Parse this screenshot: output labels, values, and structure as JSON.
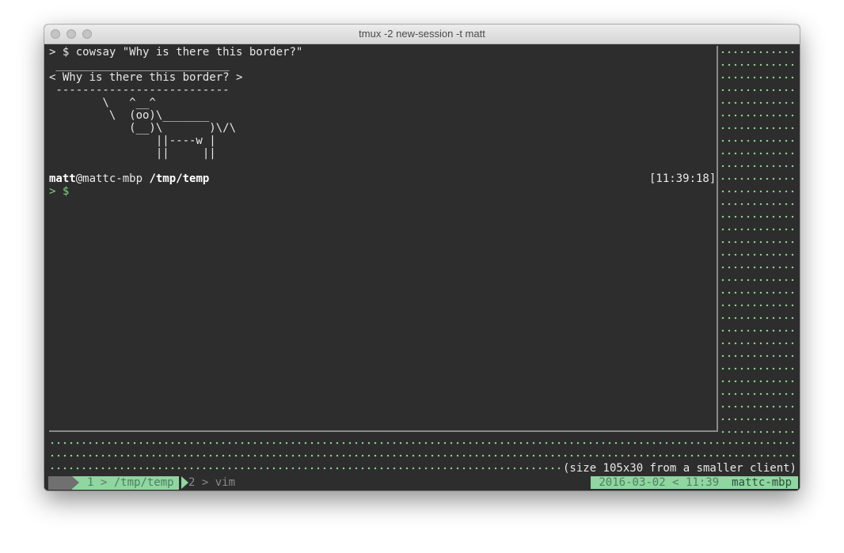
{
  "window": {
    "title": "tmux -2 new-session -t matt"
  },
  "terminal": {
    "command_prompt": "> $",
    "command": " cowsay \"Why is there this border?\"",
    "cow_lines": [
      " __________________________",
      "< Why is there this border? >",
      " --------------------------",
      "        \\   ^__^",
      "         \\  (oo)\\_______",
      "            (__)\\       )\\/\\",
      "                ||----w |",
      "                ||     ||"
    ],
    "prompt_user": "matt",
    "prompt_host": "@mattc-mbp",
    "prompt_path": " /tmp/temp",
    "prompt_time": "[11:39:18]",
    "current_prompt": "> $"
  },
  "tmux": {
    "size_message": "(size 105x30 from a smaller client)",
    "window1_label": "1 ",
    "window1_sep": ">",
    "window1_name": " /tmp/temp",
    "window2_label": "2 ",
    "window2_sep": ">",
    "window2_name": " vim",
    "date": "2016-03-02",
    "date_sep": "<",
    "time": "11:39",
    "host": "mattc-mbp"
  },
  "colors": {
    "accent_green": "#8fd6a0",
    "terminal_bg": "#2d2d2d",
    "dot_green": "#8fd48f"
  }
}
